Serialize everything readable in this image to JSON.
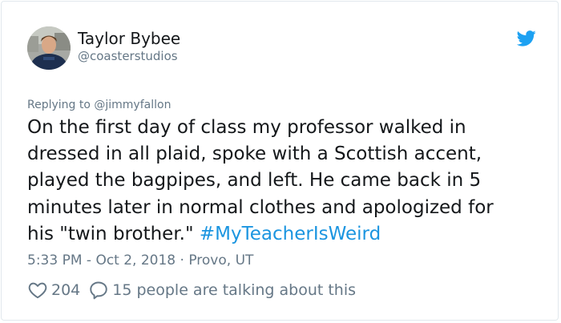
{
  "tweet": {
    "author_name": "Taylor Bybee",
    "author_handle": "@coasterstudios",
    "replying_to": "Replying to @jimmyfallon",
    "text_lines": [
      "On the first day of class my professor walked in",
      "dressed in all plaid, spoke with a Scottish accent,",
      "played the bagpipes, and left. He came back in 5",
      "minutes later in normal clothes and apologized for",
      "his \"twin brother.\" "
    ],
    "hashtag": "#MyTeacherIsWeird",
    "timestamp": "5:33 PM - Oct 2, 2018 · Provo, UT",
    "like_count": "204",
    "talking_text": "15 people are talking about this"
  },
  "icons": {
    "brand": "twitter-bird-icon",
    "like": "heart-icon",
    "reply": "speech-bubble-icon"
  },
  "colors": {
    "brand": "#1da1f2",
    "hashtag": "#1b95e0",
    "secondary_text": "#657786",
    "primary_text": "#14171a",
    "border": "#e1e8ed"
  }
}
